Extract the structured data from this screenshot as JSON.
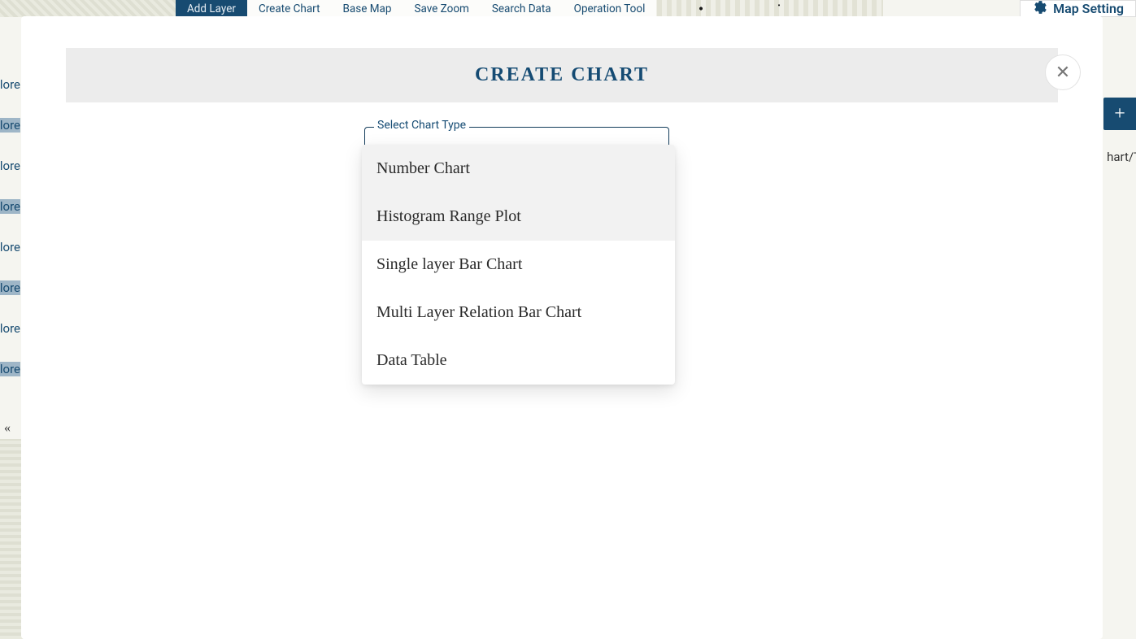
{
  "toolbar": {
    "items": [
      {
        "label": "Add Layer",
        "active": true
      },
      {
        "label": "Create Chart",
        "active": false
      },
      {
        "label": "Base Map",
        "active": false
      },
      {
        "label": "Save Zoom",
        "active": false
      },
      {
        "label": "Search Data",
        "active": false
      },
      {
        "label": "Operation Tool",
        "active": false
      }
    ]
  },
  "map_setting_label": "Map Setting",
  "left_stub_label": "lore",
  "collapse_glyph": "«",
  "floating_add_glyph": "+",
  "peek_text": "hart/T",
  "modal": {
    "title": "CREATE CHART",
    "close_glyph": "✕",
    "select_label": "Select Chart Type",
    "options": [
      "Number Chart",
      "Histogram Range Plot",
      "Single layer Bar Chart",
      "Multi Layer Relation Bar Chart",
      "Data Table"
    ],
    "hovered_index": 1
  }
}
